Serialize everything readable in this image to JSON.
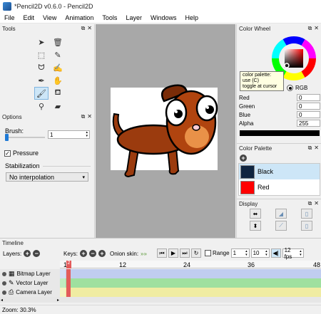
{
  "window": {
    "title": "*Pencil2D v0.6.0 - Pencil2D"
  },
  "menu": [
    "File",
    "Edit",
    "View",
    "Animation",
    "Tools",
    "Layer",
    "Windows",
    "Help"
  ],
  "tools_panel": {
    "title": "Tools"
  },
  "options_panel": {
    "title": "Options",
    "brush_label": "Brush:",
    "brush_value": "1",
    "pressure_label": "Pressure",
    "stabilization_label": "Stabilization",
    "stabilization_value": "No interpolation"
  },
  "color_wheel": {
    "title": "Color Wheel",
    "rgb_label": "RGB",
    "labels": [
      "Red",
      "Green",
      "Blue",
      "Alpha"
    ],
    "values": [
      "0",
      "0",
      "0",
      "255"
    ]
  },
  "tooltip": {
    "line1": "color palette:",
    "line2": "use (C)",
    "line3": "toggle at cursor"
  },
  "color_palette": {
    "title": "Color Palette",
    "items": [
      {
        "name": "Black",
        "color": "#0f2540"
      },
      {
        "name": "Red",
        "color": "#ff0000"
      }
    ]
  },
  "display_panel": {
    "title": "Display"
  },
  "timeline": {
    "title": "Timeline",
    "layers_label": "Layers:",
    "keys_label": "Keys:",
    "onion_label": "Onion skin:",
    "range_label": "Range",
    "range_start": "1",
    "range_end": "10",
    "fps": "12 fps",
    "ruler": [
      "1",
      "12",
      "24",
      "36",
      "48"
    ],
    "layers": [
      {
        "name": "Bitmap Layer",
        "color": "#c0cdf0"
      },
      {
        "name": "Vector Layer",
        "color": "#9fe09f"
      },
      {
        "name": "Camera Layer",
        "color": "#f0eca2"
      }
    ]
  },
  "status": {
    "zoom": "Zoom: 30.3%"
  }
}
